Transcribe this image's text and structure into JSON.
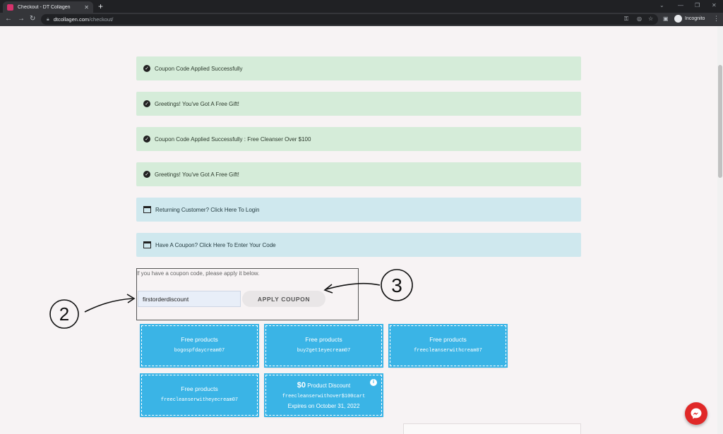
{
  "browser": {
    "tab_title": "Checkout - DT Collagen",
    "tab_close": "✕",
    "new_tab": "+",
    "url_host": "dtcollagen.com",
    "url_path": "/checkout/",
    "profile_label": "Incognito"
  },
  "notices": [
    {
      "type": "success",
      "text": "Coupon Code Applied Successfully"
    },
    {
      "type": "success",
      "text": "Greetings! You've Got A Free Gift!"
    },
    {
      "type": "success",
      "text": "Coupon Code Applied Successfully : Free Cleanser Over $100"
    },
    {
      "type": "success",
      "text": "Greetings! You've Got A Free Gift!"
    },
    {
      "type": "info",
      "text": "Returning Customer? Click Here To Login"
    },
    {
      "type": "info",
      "text": "Have A Coupon? Click Here To Enter Your Code"
    }
  ],
  "coupon_form": {
    "hint": "If you have a coupon code, please apply it below.",
    "input_value": "firstorderdiscount",
    "button_label": "APPLY COUPON"
  },
  "coupon_cards": [
    {
      "title": "Free products",
      "code": "bogospfdaycream07"
    },
    {
      "title": "Free products",
      "code": "buy2get1eyecream07"
    },
    {
      "title": "Free products",
      "code": "freecleanserwithcream07"
    },
    {
      "title": "Free products",
      "code": "freecleanserwitheyecream07"
    },
    {
      "title_amount": "$0",
      "title_suffix": " Product Discount",
      "code": "freecleanserwithover$100cart",
      "expires": "Expires on October 31, 2022",
      "info": "i"
    }
  ],
  "annotations": {
    "left": "2",
    "right": "3"
  },
  "colors": {
    "success_bg": "#d5ecd9",
    "info_bg": "#cfe8ee",
    "card_bg": "#3ab4e6",
    "messenger": "#e02828"
  },
  "icons": [
    "check-circle-icon",
    "window-icon",
    "messenger-icon",
    "info-icon",
    "lock-icon"
  ]
}
